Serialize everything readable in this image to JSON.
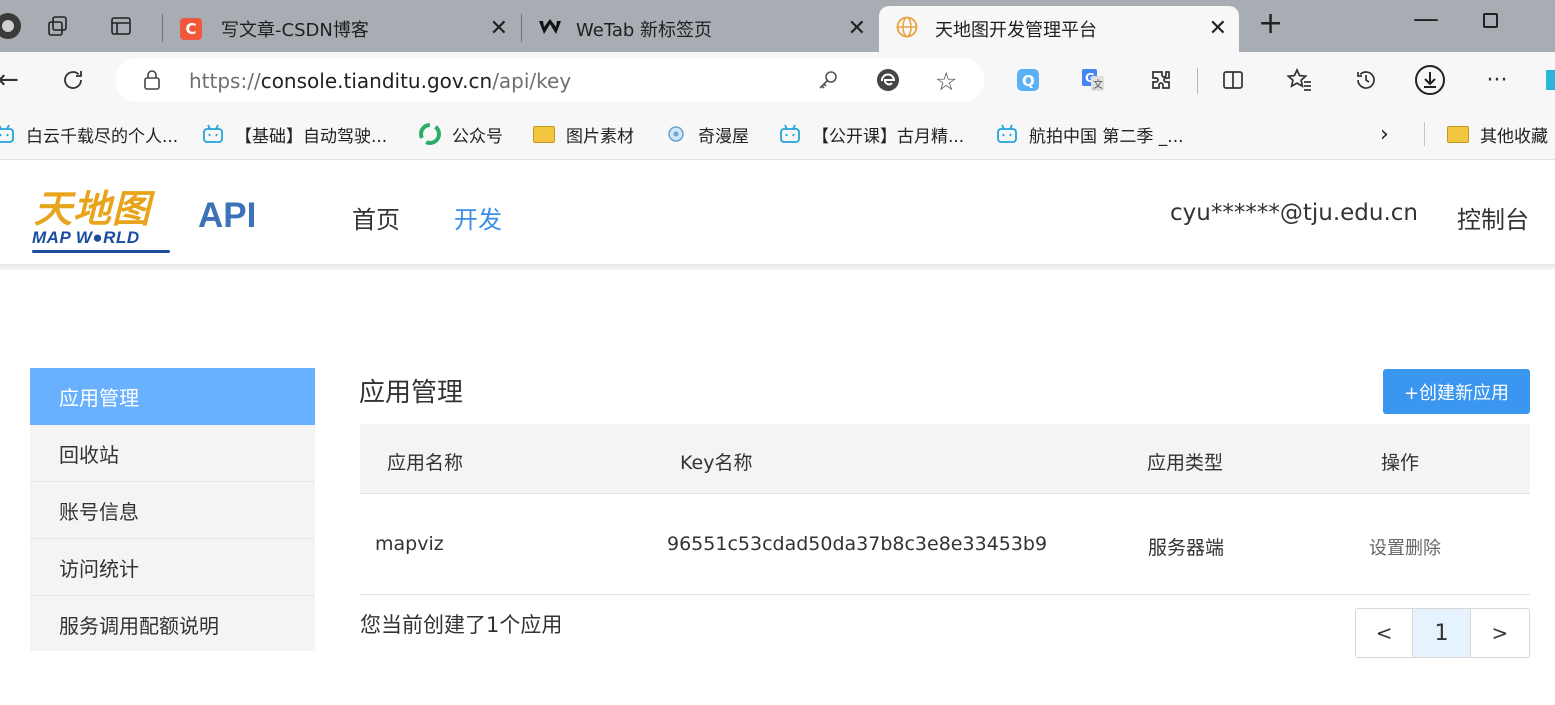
{
  "browser": {
    "tabs": [
      {
        "title": "写文章-CSDN博客",
        "favicon": "C",
        "favicon_color": "#f1573a"
      },
      {
        "title": "WeTab 新标签页",
        "favicon": "wetab-logo"
      },
      {
        "title": "天地图开发管理平台",
        "favicon": "globe"
      }
    ],
    "url_prefix": "https://",
    "url_host": "console.tianditu.gov.cn",
    "url_path": "/api/key",
    "bookmarks": [
      {
        "label": "白云千载尽的个人...",
        "icon": "bilibili-icon"
      },
      {
        "label": "【基础】自动驾驶...",
        "icon": "bilibili-icon"
      },
      {
        "label": "公众号",
        "icon": "wechat-icon"
      },
      {
        "label": "图片素材",
        "icon": "folder-icon"
      },
      {
        "label": "奇漫屋",
        "icon": "site-icon"
      },
      {
        "label": "【公开课】古月精...",
        "icon": "bilibili-icon"
      },
      {
        "label": "航拍中国 第二季 _...",
        "icon": "bilibili-icon"
      },
      {
        "label": "其他收藏",
        "icon": "folder-icon"
      }
    ]
  },
  "site": {
    "logo_cn": "天地图",
    "logo_en": "MAP W●RLD",
    "api_label": "API",
    "nav": [
      {
        "label": "首页",
        "active": false
      },
      {
        "label": "开发",
        "active": true
      }
    ],
    "user": "cyu******@tju.edu.cn",
    "console": "控制台",
    "accent": "#3a8ee6"
  },
  "sidebar": {
    "items": [
      {
        "label": "应用管理",
        "active": true
      },
      {
        "label": "回收站"
      },
      {
        "label": "账号信息"
      },
      {
        "label": "访问统计"
      },
      {
        "label": "服务调用配额说明"
      }
    ]
  },
  "main": {
    "title": "应用管理",
    "create_button": "+创建新应用",
    "columns": [
      "应用名称",
      "Key名称",
      "应用类型",
      "操作"
    ],
    "rows": [
      {
        "name": "mapviz",
        "key": "96551c53cdad50da37b8c3e8e33453b9",
        "type": "服务器端",
        "ops": [
          "设置",
          "删除"
        ]
      }
    ],
    "summary": "您当前创建了1个应用",
    "pagination": {
      "prev": "<",
      "current": "1",
      "next": ">"
    }
  }
}
